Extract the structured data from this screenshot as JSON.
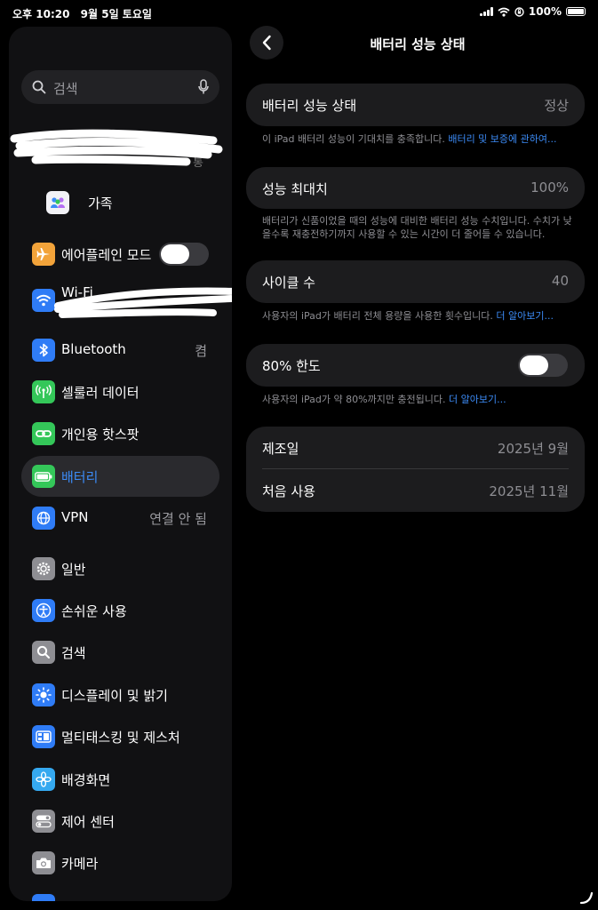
{
  "status": {
    "time": "오후 10:20",
    "date": "9월 5일 토요일",
    "battery": "100%"
  },
  "sidebar": {
    "search_placeholder": "검색",
    "profile_fragment": "통",
    "family_label": "가족",
    "items": [
      {
        "label": "에어플레인 모드",
        "icon": "airplane-icon",
        "color": "#f2a33a"
      },
      {
        "label": "Wi-Fi",
        "icon": "wifi-icon",
        "color": "#2f7cf6"
      },
      {
        "label": "Bluetooth",
        "value": "켬",
        "icon": "bluetooth-icon",
        "color": "#2f7cf6"
      },
      {
        "label": "셀룰러 데이터",
        "icon": "antenna-icon",
        "color": "#34c759"
      },
      {
        "label": "개인용 핫스팟",
        "icon": "link-icon",
        "color": "#34c759"
      },
      {
        "label": "배터리",
        "icon": "battery-icon",
        "color": "#34c759"
      },
      {
        "label": "VPN",
        "value": "연결 안 됨",
        "icon": "globe-icon",
        "color": "#2f7cf6"
      },
      {
        "label": "일반",
        "icon": "gear-icon",
        "color": "#8e8e93"
      },
      {
        "label": "손쉬운 사용",
        "icon": "accessibility-icon",
        "color": "#2f7cf6"
      },
      {
        "label": "검색",
        "icon": "search-icon",
        "color": "#8e8e93"
      },
      {
        "label": "디스플레이 및 밝기",
        "icon": "sun-icon",
        "color": "#2f7cf6"
      },
      {
        "label": "멀티태스킹 및 제스처",
        "icon": "multitask-icon",
        "color": "#2f7cf6"
      },
      {
        "label": "배경화면",
        "icon": "flower-icon",
        "color": "#35a9f0"
      },
      {
        "label": "제어 센터",
        "icon": "switches-icon",
        "color": "#8e8e93"
      },
      {
        "label": "카메라",
        "icon": "camera-icon",
        "color": "#8e8e93"
      }
    ]
  },
  "detail": {
    "title": "배터리 성능 상태",
    "health": {
      "label": "배터리 성능 상태",
      "value": "정상"
    },
    "health_note": "이 iPad 배터리 성능이 기대치를 충족합니다.",
    "health_link": "배터리 및 보증에 관하여...",
    "max": {
      "label": "성능 최대치",
      "value": "100%"
    },
    "max_note": "배터리가 신품이었을 때의 성능에 대비한 배터리 성능 수치입니다. 수치가 낮을수록 재충전하기까지 사용할 수 있는 시간이 더 줄어들 수 있습니다.",
    "cycle": {
      "label": "사이클 수",
      "value": "40"
    },
    "cycle_note": "사용자의 iPad가 배터리 전체 용량을 사용한 횟수입니다.",
    "cycle_link": "더 알아보기...",
    "limit": {
      "label": "80% 한도",
      "on": false
    },
    "limit_note": "사용자의 iPad가 약 80%까지만 충전됩니다.",
    "limit_link": "더 알아보기...",
    "manufacture": {
      "label": "제조일",
      "value": "2025년 9월"
    },
    "first_use": {
      "label": "처음 사용",
      "value": "2025년 11월"
    }
  }
}
